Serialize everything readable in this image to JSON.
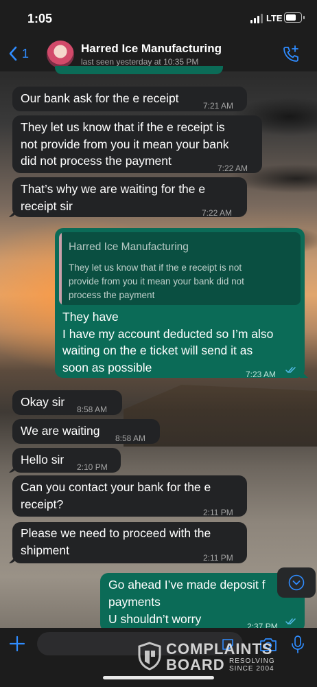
{
  "status_bar": {
    "time": "1:05",
    "network": "LTE"
  },
  "header": {
    "back_count": "1",
    "contact_name": "Harred Ice Manufacturing",
    "last_seen": "last seen yesterday at 10:35 PM",
    "back_icon": "chevron-left-icon",
    "call_icon": "add-call-icon"
  },
  "messages": [
    {
      "dir": "in",
      "lines": [
        "Our bank ask for the e receipt"
      ],
      "time": "7:21 AM"
    },
    {
      "dir": "in",
      "lines": [
        "They let us know that if the e receipt is",
        "not provide from you it mean your bank",
        "did not process the payment"
      ],
      "time": "7:22 AM"
    },
    {
      "dir": "in",
      "lines": [
        "That’s why we are waiting for the e",
        "receipt sir"
      ],
      "time": "7:22 AM"
    },
    {
      "dir": "out",
      "quote": {
        "author": "Harred Ice Manufacturing",
        "lines": [
          "They let us know that if the e receipt is not",
          "provide from you it mean your bank did not",
          "process the payment"
        ]
      },
      "lines": [
        "They have",
        "I have my account deducted so I’m also",
        "waiting on the e ticket will send it as",
        "soon as possible"
      ],
      "time": "7:23 AM"
    },
    {
      "dir": "in",
      "lines": [
        "Okay sir"
      ],
      "time": "8:58 AM"
    },
    {
      "dir": "in",
      "lines": [
        "We are waiting"
      ],
      "time": "8:58 AM"
    },
    {
      "dir": "in",
      "lines": [
        "Hello sir"
      ],
      "time": "2:10 PM"
    },
    {
      "dir": "in",
      "lines": [
        "Can you contact your bank for the e",
        "receipt?"
      ],
      "time": "2:11 PM"
    },
    {
      "dir": "in",
      "lines": [
        "Please we need to proceed with the",
        "shipment"
      ],
      "time": "2:11 PM"
    },
    {
      "dir": "out",
      "lines": [
        "Go ahead I’ve made deposit f",
        "payments",
        "U shouldn’t worry"
      ],
      "time": "2:37 PM"
    }
  ],
  "input": {
    "placeholder": ""
  },
  "watermark": {
    "big1": "COMPLAINTS",
    "big2": "BOARD",
    "small1": "RESOLVING",
    "small2": "SINCE 2004"
  },
  "colors": {
    "accent": "#2f8cff",
    "outgoing": "#0b6b57",
    "incoming": "#222325",
    "read_tick": "#53bdeb"
  }
}
